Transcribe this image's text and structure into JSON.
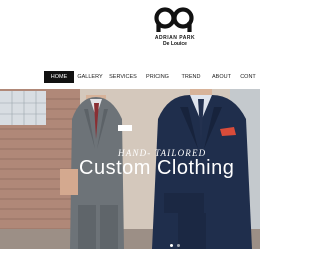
{
  "brand": {
    "name": "ADRIAN PARK",
    "subtitle": "De Louice",
    "logo_icon": "ap-monogram-icon"
  },
  "nav": {
    "items": [
      {
        "label": "HOME",
        "active": true
      },
      {
        "label": "GALLERY",
        "active": false
      },
      {
        "label": "SERVICES",
        "active": false
      },
      {
        "label": "PRICING",
        "active": false
      },
      {
        "label": "TREND",
        "active": false
      },
      {
        "label": "ABOUT",
        "active": false
      },
      {
        "label": "CONT",
        "active": false
      }
    ]
  },
  "hero": {
    "tagline": "HAND- TAILORED",
    "headline": "Custom Clothing",
    "slide_count": 2,
    "active_slide": 1
  },
  "colors": {
    "nav_active_bg": "#111111",
    "text": "#222222",
    "hero_text": "#ffffff"
  }
}
